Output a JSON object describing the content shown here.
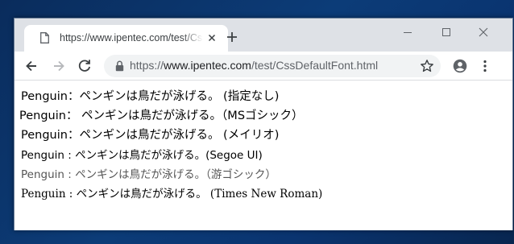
{
  "browser": {
    "tab": {
      "title": "https://www.ipentec.com/test/CssDefaultFont.html",
      "favicon_icon": "page-icon",
      "close_icon": "close-icon"
    },
    "new_tab_icon": "plus-icon",
    "window_controls": [
      "minimize-icon",
      "maximize-icon",
      "close-icon"
    ],
    "toolbar": {
      "back_icon": "arrow-left-icon",
      "forward_icon": "arrow-right-icon",
      "reload_icon": "reload-icon",
      "url_scheme": "https://",
      "url_host": "www.ipentec.com",
      "url_path": "/test/CssDefaultFont.html",
      "bookmark_icon": "star-icon",
      "profile_icon": "account-circle-icon",
      "menu_icon": "more-vert-icon"
    }
  },
  "page": {
    "lines": [
      {
        "text": "Penguin：ペンギンは鳥だが泳げる。 (指定なし)"
      },
      {
        "text": "Penguin： ペンギンは鳥だが泳げる。（MSゴシック）"
      },
      {
        "text": "Penguin：ペンギンは鳥だが泳げる。 (メイリオ)"
      },
      {
        "text": "Penguin : ペンギンは鳥だが泳げる。(Segoe UI)"
      },
      {
        "text": "Penguin : ペンギンは鳥だが泳げる。（游ゴシック）"
      },
      {
        "text": "Penguin : ペンギンは鳥だが泳げる。 (Times New Roman)"
      }
    ]
  },
  "colors": {
    "desktop": "#0c3c78",
    "titlebar": "#dee1e6",
    "omnibox": "#f1f3f4",
    "icon": "#5f6368"
  }
}
